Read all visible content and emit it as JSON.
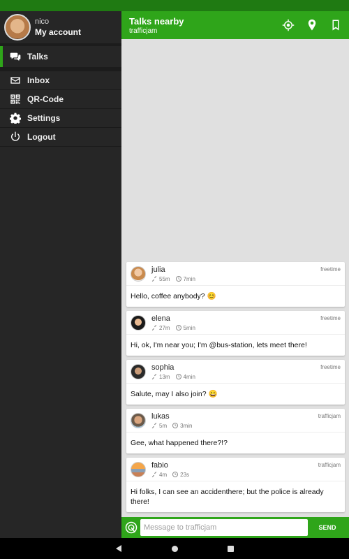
{
  "sidebar": {
    "account": {
      "username": "nico",
      "link": "My account"
    },
    "items": [
      {
        "label": "Talks",
        "icon": "chat-bubbles-icon"
      },
      {
        "label": "Inbox",
        "icon": "envelope-icon"
      },
      {
        "label": "QR-Code",
        "icon": "qr-code-icon"
      },
      {
        "label": "Settings",
        "icon": "gear-icon"
      },
      {
        "label": "Logout",
        "icon": "power-icon"
      }
    ]
  },
  "appbar": {
    "title": "Talks nearby",
    "subtitle": "trafficjam",
    "actions": [
      "crosshair-icon",
      "location-pin-icon",
      "bookmark-icon"
    ]
  },
  "messages": [
    {
      "name": "julia",
      "distance": "55m",
      "time": "7min",
      "topic": "freetime",
      "text": "Hello, coffee anybody? 😊"
    },
    {
      "name": "elena",
      "distance": "27m",
      "time": "5min",
      "topic": "freetime",
      "text": "Hi, ok, I'm near you; I'm @bus-station, lets meet there!"
    },
    {
      "name": "sophia",
      "distance": "13m",
      "time": "4min",
      "topic": "freetime",
      "text": "Salute, may I also join? 😀"
    },
    {
      "name": "lukas",
      "distance": "5m",
      "time": "3min",
      "topic": "trafficjam",
      "text": "Gee, what happened there?!?"
    },
    {
      "name": "fabio",
      "distance": "4m",
      "time": "23s",
      "topic": "trafficjam",
      "text": "Hi folks, I can see an accidenthere; but the police is already there!"
    }
  ],
  "composer": {
    "placeholder": "Message to trafficjam",
    "send_label": "SEND"
  },
  "colors": {
    "accent": "#2fa51a",
    "statusbar": "#1f7a12",
    "sidebar": "#262626"
  }
}
